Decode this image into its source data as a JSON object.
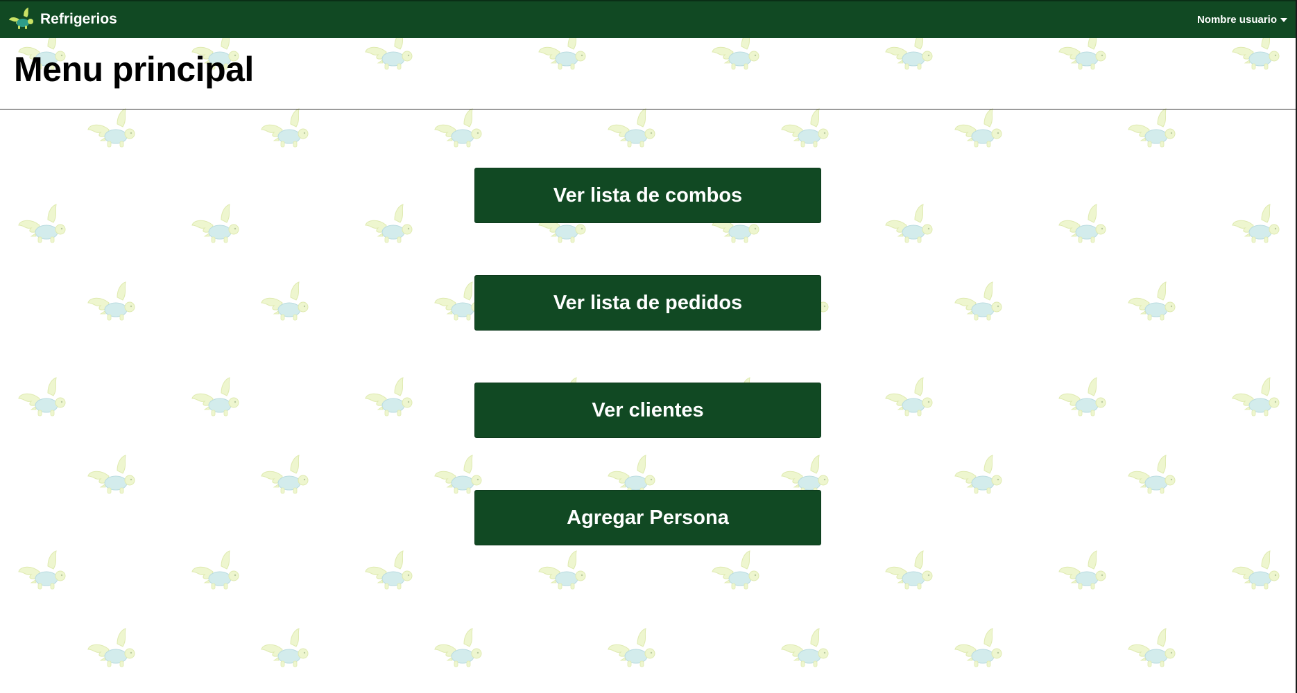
{
  "navbar": {
    "brand_name": "Refrigerios",
    "brand_icon": "turtle-logo-icon",
    "user_menu_label": "Nombre usuario",
    "user_menu_icon": "caret-down-icon",
    "background_color": "#114923"
  },
  "page": {
    "title": "Menu principal",
    "background_pattern_icon": "flying-turtle-icon"
  },
  "menu": {
    "buttons": [
      {
        "label": "Ver lista de combos"
      },
      {
        "label": "Ver lista de pedidos"
      },
      {
        "label": "Ver clientes"
      },
      {
        "label": "Agregar Persona"
      }
    ],
    "button_color": "#114923",
    "button_text_color": "#ffffff"
  }
}
